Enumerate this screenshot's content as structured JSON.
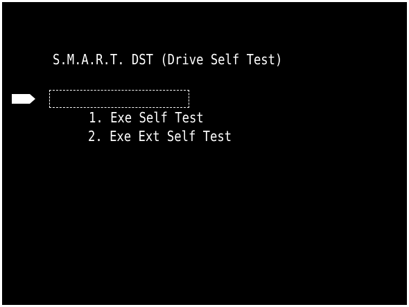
{
  "window": {
    "background": "#000000",
    "text_color": "#ffffff"
  },
  "title": "S.M.A.R.T. DST (Drive Self Test)",
  "pointer": {
    "icon": "arrow-pointer-icon"
  },
  "menu": {
    "items": [
      {
        "label": "1. Exe Self Test",
        "selected": true
      },
      {
        "label": "2. Exe Ext Self Test",
        "selected": false
      }
    ]
  }
}
